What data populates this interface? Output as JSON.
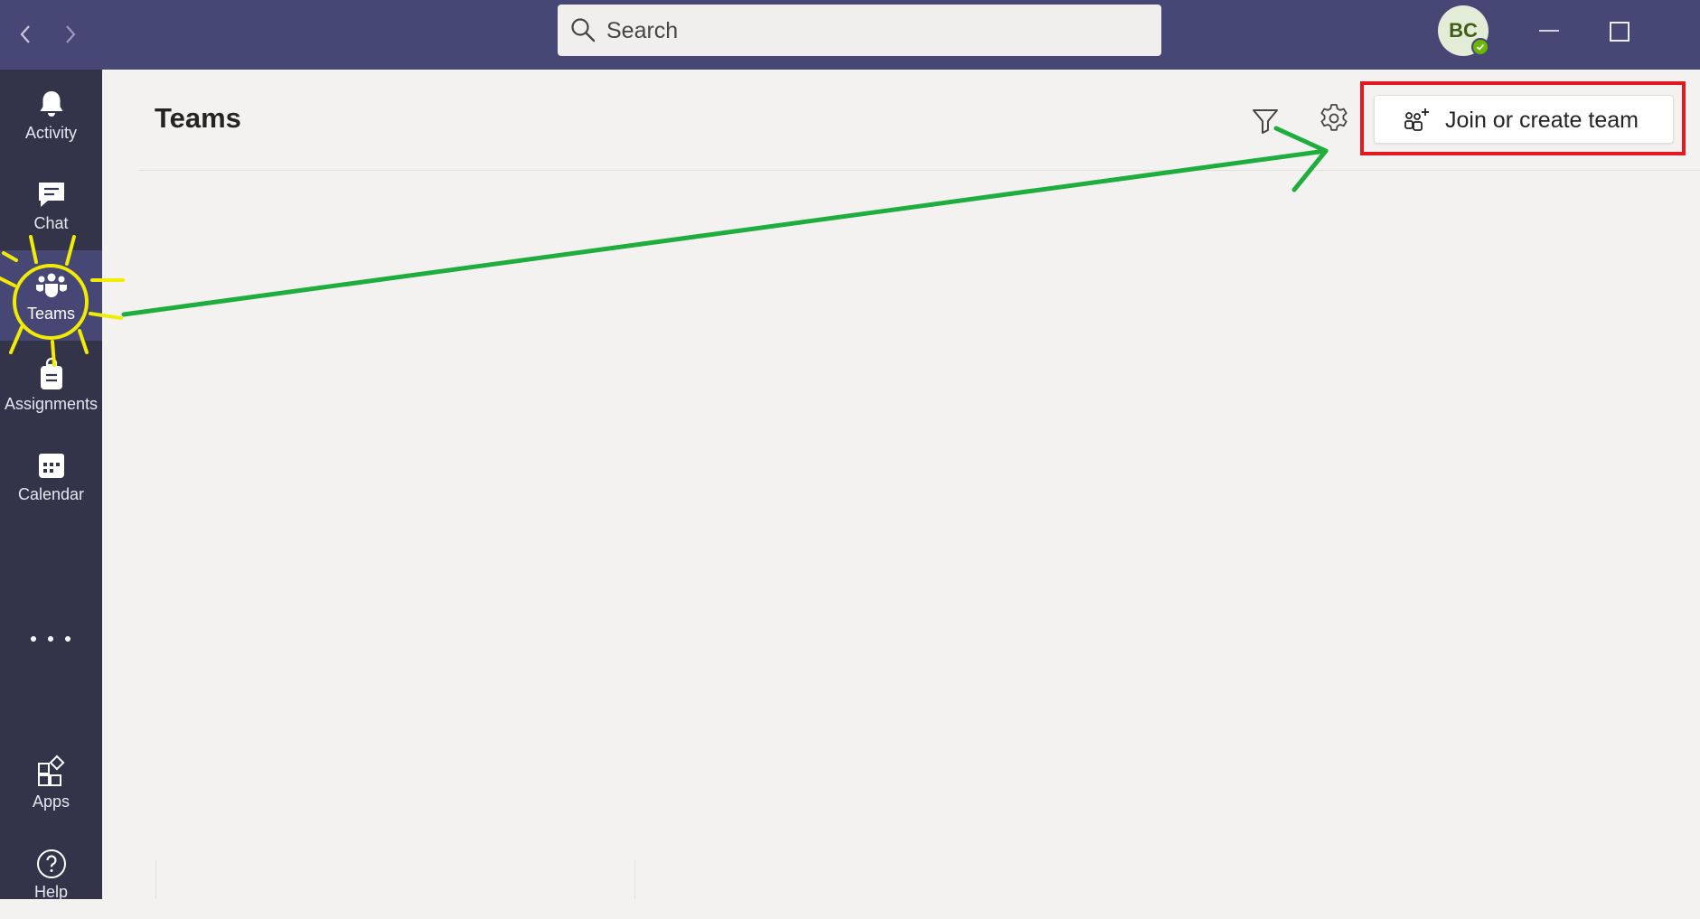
{
  "titlebar": {
    "back_icon": "chevron-left-icon",
    "forward_icon": "chevron-right-icon",
    "search": {
      "placeholder": "Search",
      "value": ""
    },
    "avatar": {
      "initials": "BC",
      "presence": "available",
      "presence_color": "#6bb700"
    },
    "minimize_icon": "minimize-icon",
    "maximize_icon": "maximize-icon"
  },
  "rail": {
    "items": [
      {
        "label": "Activity",
        "icon": "bell-icon",
        "active": false
      },
      {
        "label": "Chat",
        "icon": "chat-icon",
        "active": false
      },
      {
        "label": "Teams",
        "icon": "teams-icon",
        "active": true
      },
      {
        "label": "Assignments",
        "icon": "assignments-icon",
        "active": false
      },
      {
        "label": "Calendar",
        "icon": "calendar-icon",
        "active": false
      }
    ],
    "more_icon": "more-icon",
    "bottom_items": [
      {
        "label": "Apps",
        "icon": "apps-icon"
      },
      {
        "label": "Help",
        "icon": "help-icon"
      }
    ]
  },
  "main": {
    "title": "Teams",
    "filter_icon": "filter-icon",
    "settings_icon": "gear-icon",
    "join_button": {
      "label": "Join or create team",
      "icon": "add-team-icon"
    }
  },
  "colors": {
    "titlebar": "#464775",
    "rail": "#33344a",
    "content": "#f3f2f1",
    "annotation_arrow": "#1fad3e",
    "annotation_highlight": "#f2ec00",
    "annotation_box": "#e2191e"
  }
}
